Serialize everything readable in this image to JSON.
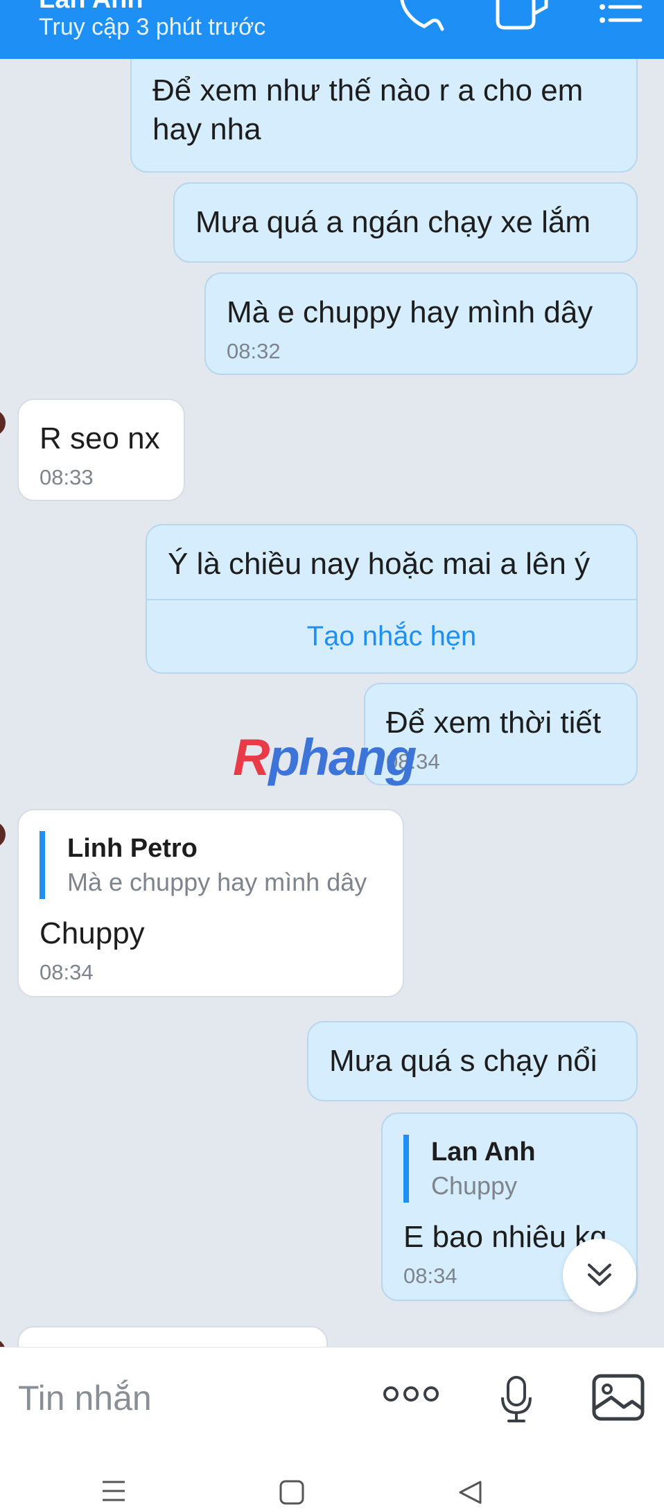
{
  "header": {
    "contact_name": "Lan Anh",
    "status": "Truy cập 3 phút trước",
    "icons": [
      "phone-icon",
      "video-call-icon",
      "menu-list-icon"
    ]
  },
  "messages": [
    {
      "side": "out",
      "text": "Để xem như thế nào r a cho em hay nha"
    },
    {
      "side": "out",
      "text": "Mưa quá a ngán chạy xe lắm"
    },
    {
      "side": "out",
      "text": "Mà e chuppy hay mình dây",
      "time": "08:32"
    },
    {
      "side": "in",
      "text": "R seo nx",
      "time": "08:33"
    },
    {
      "side": "out",
      "text": "Ý là chiều nay hoặc mai a lên ý",
      "action": "Tạo nhắc hẹn"
    },
    {
      "side": "out",
      "text": "Để xem thời tiết",
      "time": "08:34"
    },
    {
      "side": "in",
      "quote_name": "Linh Petro",
      "quote_text": "Mà e chuppy hay mình dây",
      "text": "Chuppy",
      "time": "08:34"
    },
    {
      "side": "out",
      "text": "Mưa quá s chạy nổi"
    },
    {
      "side": "out",
      "quote_name": "Lan Anh",
      "quote_text": "Chuppy",
      "text": "E bao nhiêu kg",
      "time": "08:34"
    }
  ],
  "watermark": {
    "part1": "R",
    "part2": "phang"
  },
  "input": {
    "placeholder": "Tin nhắn",
    "icons": [
      "more-options-icon",
      "microphone-icon",
      "image-icon"
    ]
  },
  "navbar": {
    "icons": [
      "recent-apps-icon",
      "home-icon",
      "back-icon"
    ]
  },
  "colors": {
    "accent": "#1e90f5",
    "outgoing_bubble": "#d5edfd",
    "incoming_bubble": "#ffffff",
    "background": "#e3e8ef"
  }
}
